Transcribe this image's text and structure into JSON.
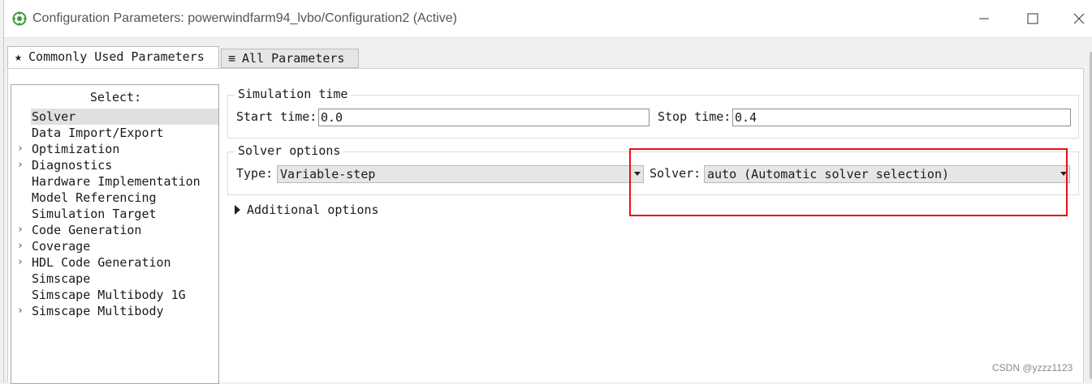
{
  "window": {
    "title": "Configuration Parameters: powerwindfarm94_lvbo/Configuration2 (Active)"
  },
  "tabs": [
    {
      "label": "Commonly Used Parameters",
      "icon": "star-icon",
      "glyph": "★",
      "active": true
    },
    {
      "label": "All Parameters",
      "icon": "list-icon",
      "glyph": "≡",
      "active": false
    }
  ],
  "tree": {
    "header": "Select:",
    "items": [
      {
        "label": "Solver",
        "expandable": false,
        "selected": true
      },
      {
        "label": "Data Import/Export",
        "expandable": false
      },
      {
        "label": "Optimization",
        "expandable": true
      },
      {
        "label": "Diagnostics",
        "expandable": true
      },
      {
        "label": "Hardware Implementation",
        "expandable": false
      },
      {
        "label": "Model Referencing",
        "expandable": false
      },
      {
        "label": "Simulation Target",
        "expandable": false
      },
      {
        "label": "Code Generation",
        "expandable": true
      },
      {
        "label": "Coverage",
        "expandable": true
      },
      {
        "label": "HDL Code Generation",
        "expandable": true
      },
      {
        "label": "Simscape",
        "expandable": false
      },
      {
        "label": "Simscape Multibody 1G",
        "expandable": false
      },
      {
        "label": "Simscape Multibody",
        "expandable": true
      }
    ],
    "arrow_glyph": "›"
  },
  "simulation_time": {
    "title": "Simulation time",
    "start_label": "Start time:",
    "start_value": "0.0",
    "stop_label": "Stop time:",
    "stop_value": "0.4"
  },
  "solver_options": {
    "title": "Solver options",
    "type_label": "Type:",
    "type_value": "Variable-step",
    "solver_label": "Solver:",
    "solver_value": "auto (Automatic solver selection)"
  },
  "additional_options": {
    "label": "Additional options"
  },
  "watermark": "CSDN @yzzz1123",
  "colors": {
    "highlight": "#e8101a",
    "icon_green": "#4caf50"
  }
}
